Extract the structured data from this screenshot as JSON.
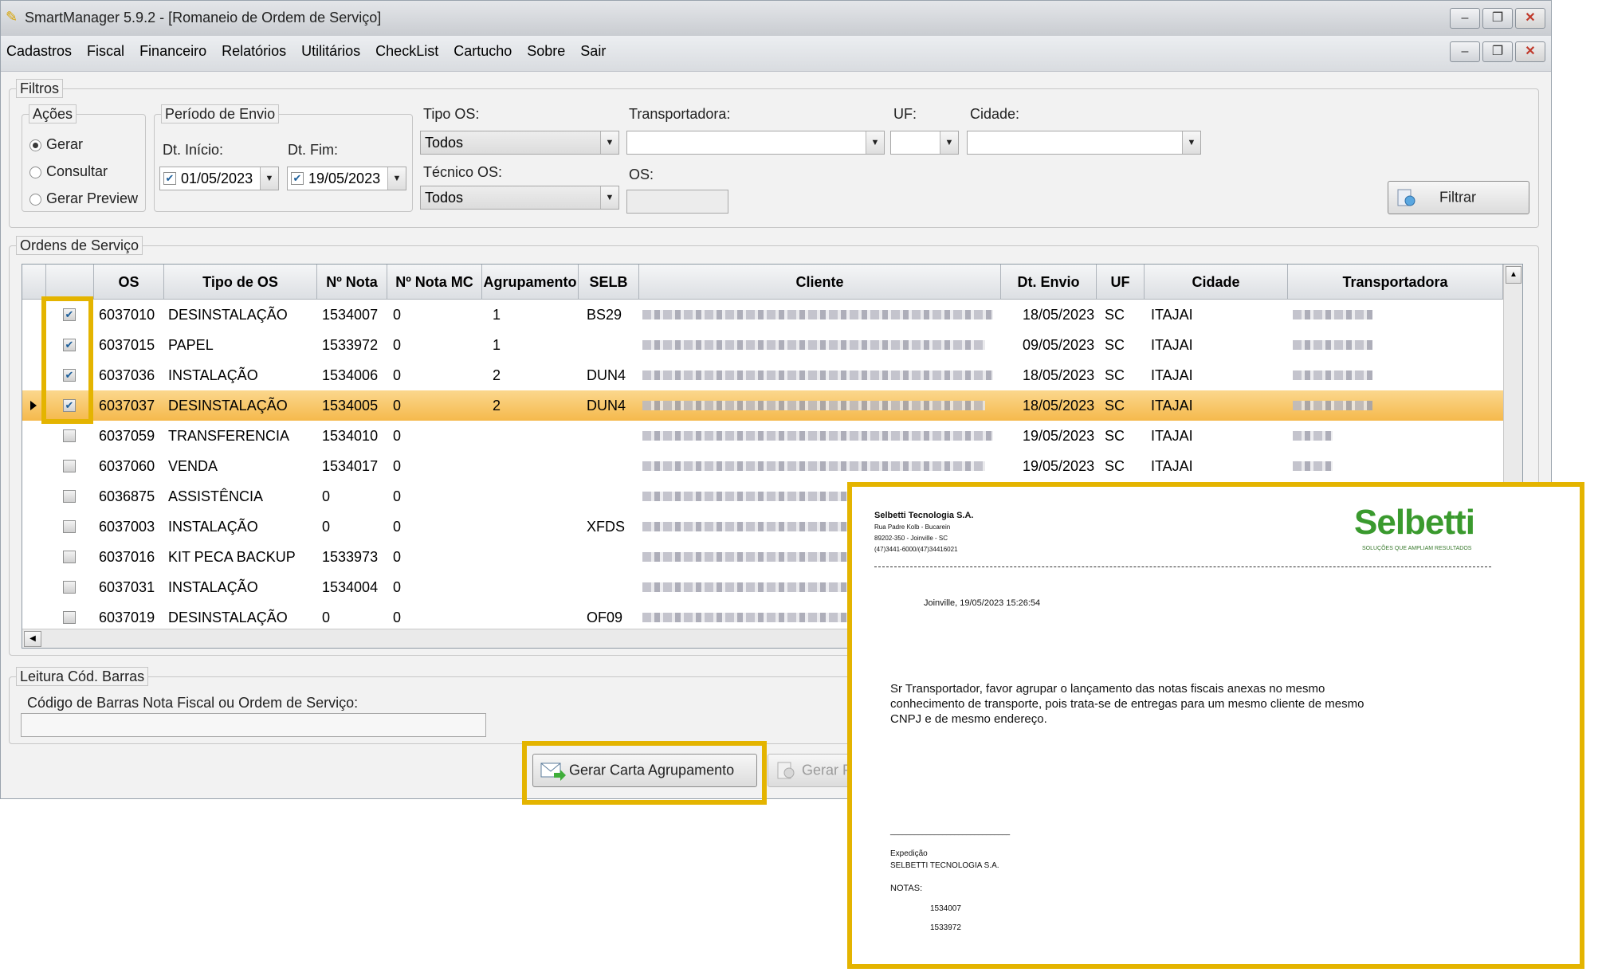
{
  "window": {
    "title": "SmartManager 5.9.2 - [Romaneio de Ordem de Serviço]",
    "min_label": "–",
    "max_label": "❐",
    "close_label": "✕"
  },
  "menu": [
    "Cadastros",
    "Fiscal",
    "Financeiro",
    "Relatórios",
    "Utilitários",
    "CheckList",
    "Cartucho",
    "Sobre",
    "Sair"
  ],
  "filters": {
    "legend": "Filtros",
    "acoes": {
      "legend": "Ações",
      "options": [
        "Gerar",
        "Consultar",
        "Gerar Preview"
      ],
      "selected": "Gerar"
    },
    "periodo": {
      "legend": "Período de Envio",
      "start_label": "Dt. Início:",
      "start_value": "01/05/2023",
      "end_label": "Dt. Fim:",
      "end_value": "19/05/2023"
    },
    "tipo_os_label": "Tipo OS:",
    "tipo_os_value": "Todos",
    "tecnico_label": "Técnico OS:",
    "tecnico_value": "Todos",
    "transportadora_label": "Transportadora:",
    "transportadora_value": "",
    "uf_label": "UF:",
    "uf_value": "",
    "cidade_label": "Cidade:",
    "cidade_value": "",
    "os_label": "OS:",
    "os_value": "",
    "filtrar_label": "Filtrar"
  },
  "orders": {
    "legend": "Ordens de Serviço",
    "columns": [
      "OS",
      "Tipo de OS",
      "Nº Nota",
      "Nº Nota MC",
      "Agrupamento",
      "SELB",
      "Cliente",
      "Dt. Envio",
      "UF",
      "Cidade",
      "Transportadora"
    ],
    "rows": [
      {
        "checked": true,
        "os": "6037010",
        "tipo": "DESINSTALAÇÃO",
        "nota": "1534007",
        "nota_mc": "0",
        "agrup": "1",
        "selb": "BS29",
        "envio": "18/05/2023",
        "uf": "SC",
        "cidade": "ITAJAI",
        "selected": false
      },
      {
        "checked": true,
        "os": "6037015",
        "tipo": "PAPEL",
        "nota": "1533972",
        "nota_mc": "0",
        "agrup": "1",
        "selb": "",
        "envio": "09/05/2023",
        "uf": "SC",
        "cidade": "ITAJAI",
        "selected": false
      },
      {
        "checked": true,
        "os": "6037036",
        "tipo": "INSTALAÇÃO",
        "nota": "1534006",
        "nota_mc": "0",
        "agrup": "2",
        "selb": "DUN4",
        "envio": "18/05/2023",
        "uf": "SC",
        "cidade": "ITAJAI",
        "selected": false
      },
      {
        "checked": true,
        "os": "6037037",
        "tipo": "DESINSTALAÇÃO",
        "nota": "1534005",
        "nota_mc": "0",
        "agrup": "2",
        "selb": "DUN4",
        "envio": "18/05/2023",
        "uf": "SC",
        "cidade": "ITAJAI",
        "selected": true
      },
      {
        "checked": false,
        "os": "6037059",
        "tipo": "TRANSFERENCIA",
        "nota": "1534010",
        "nota_mc": "0",
        "agrup": "",
        "selb": "",
        "envio": "19/05/2023",
        "uf": "SC",
        "cidade": "ITAJAI",
        "selected": false
      },
      {
        "checked": false,
        "os": "6037060",
        "tipo": "VENDA",
        "nota": "1534017",
        "nota_mc": "0",
        "agrup": "",
        "selb": "",
        "envio": "19/05/2023",
        "uf": "SC",
        "cidade": "ITAJAI",
        "selected": false
      },
      {
        "checked": false,
        "os": "6036875",
        "tipo": "ASSISTÊNCIA",
        "nota": "0",
        "nota_mc": "0",
        "agrup": "",
        "selb": "",
        "envio": "",
        "uf": "",
        "cidade": "",
        "selected": false
      },
      {
        "checked": false,
        "os": "6037003",
        "tipo": "INSTALAÇÃO",
        "nota": "0",
        "nota_mc": "0",
        "agrup": "",
        "selb": "XFDS",
        "envio": "",
        "uf": "",
        "cidade": "",
        "selected": false
      },
      {
        "checked": false,
        "os": "6037016",
        "tipo": "KIT PECA BACKUP",
        "nota": "1533973",
        "nota_mc": "0",
        "agrup": "",
        "selb": "",
        "envio": "",
        "uf": "",
        "cidade": "",
        "selected": false
      },
      {
        "checked": false,
        "os": "6037031",
        "tipo": "INSTALAÇÃO",
        "nota": "1534004",
        "nota_mc": "0",
        "agrup": "",
        "selb": "",
        "envio": "",
        "uf": "",
        "cidade": "",
        "selected": false
      },
      {
        "checked": false,
        "os": "6037019",
        "tipo": "DESINSTALAÇÃO",
        "nota": "0",
        "nota_mc": "0",
        "agrup": "",
        "selb": "OF09",
        "envio": "",
        "uf": "",
        "cidade": "",
        "selected": false
      }
    ]
  },
  "barcode": {
    "legend": "Leitura Cód. Barras",
    "label": "Código de Barras Nota Fiscal ou Ordem de Serviço:",
    "value": ""
  },
  "actions": {
    "gerar_carta": "Gerar Carta Agrupamento",
    "gerar_preview_partial": "Gerar P"
  },
  "preview": {
    "company": "Selbetti Tecnologia S.A.",
    "address1": "Rua Padre Kolb - Bucarein",
    "address2": "89202-350 - Joinville - SC",
    "phone": "(47)3441-6000/(47)34416021",
    "logo": "Selbetti",
    "tagline": "SOLUÇÕES QUE AMPLIAM RESULTADOS",
    "date_line": "Joinville, 19/05/2023 15:26:54",
    "body_line1": "Sr Transportador, favor agrupar o lançamento das notas fiscais anexas no mesmo",
    "body_line2": "conhecimento de transporte, pois trata-se de entregas para um mesmo cliente de mesmo",
    "body_line3": "CNPJ e de mesmo endereço.",
    "signature_line": "______________________________",
    "sign_role": "Expedição",
    "sign_company": "SELBETTI TECNOLOGIA S.A.",
    "notes_label": "NOTAS:",
    "notes": [
      "1534007",
      "1533972"
    ]
  },
  "colors": {
    "highlight": "#e4b400",
    "selected_row": "#f5b94c",
    "logo_green": "#3a9a2e"
  }
}
